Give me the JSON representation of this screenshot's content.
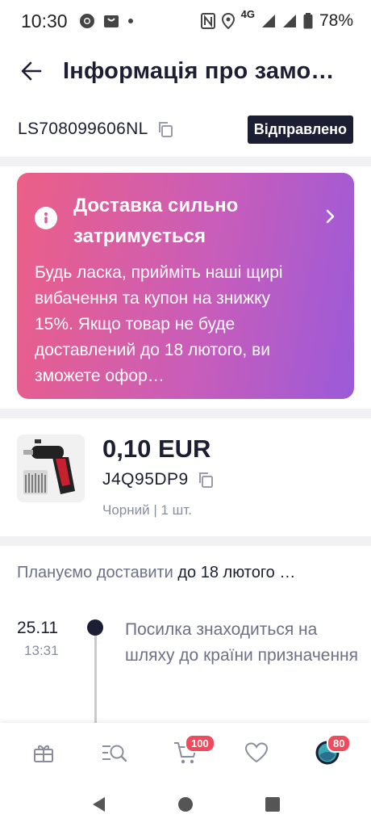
{
  "status_bar": {
    "time": "10:30",
    "network": "4G",
    "battery": "78%"
  },
  "header": {
    "title": "Інформація про замо…",
    "back_icon": "arrow-left-icon"
  },
  "order": {
    "id": "LS708099606NL",
    "status": "Відправлено"
  },
  "delay_card": {
    "title": "Доставка сильно затримується",
    "text": "Будь ласка, прийміть наші щирі вибачення та купон на знижку 15%. Якщо товар не буде доставлений до 18 лютого, ви зможете офор…"
  },
  "product": {
    "price": "0,10 EUR",
    "sku": "J4Q95DP9",
    "variant": "Чорний | 1 шт."
  },
  "plan": {
    "label": "Плануємо доставити",
    "value": " до 18 лютого …"
  },
  "tracking": [
    {
      "date": "25.11",
      "time": "13:31",
      "text": "Посилка знаходиться на шляху до країни призначення"
    }
  ],
  "bottom_nav": {
    "cart_badge": "100",
    "profile_badge": "80"
  },
  "colors": {
    "primary": "#1c1f33",
    "card_gradient_start": "#ec5f86",
    "card_gradient_end": "#9b5ad9",
    "badge": "#ef4b5c"
  }
}
